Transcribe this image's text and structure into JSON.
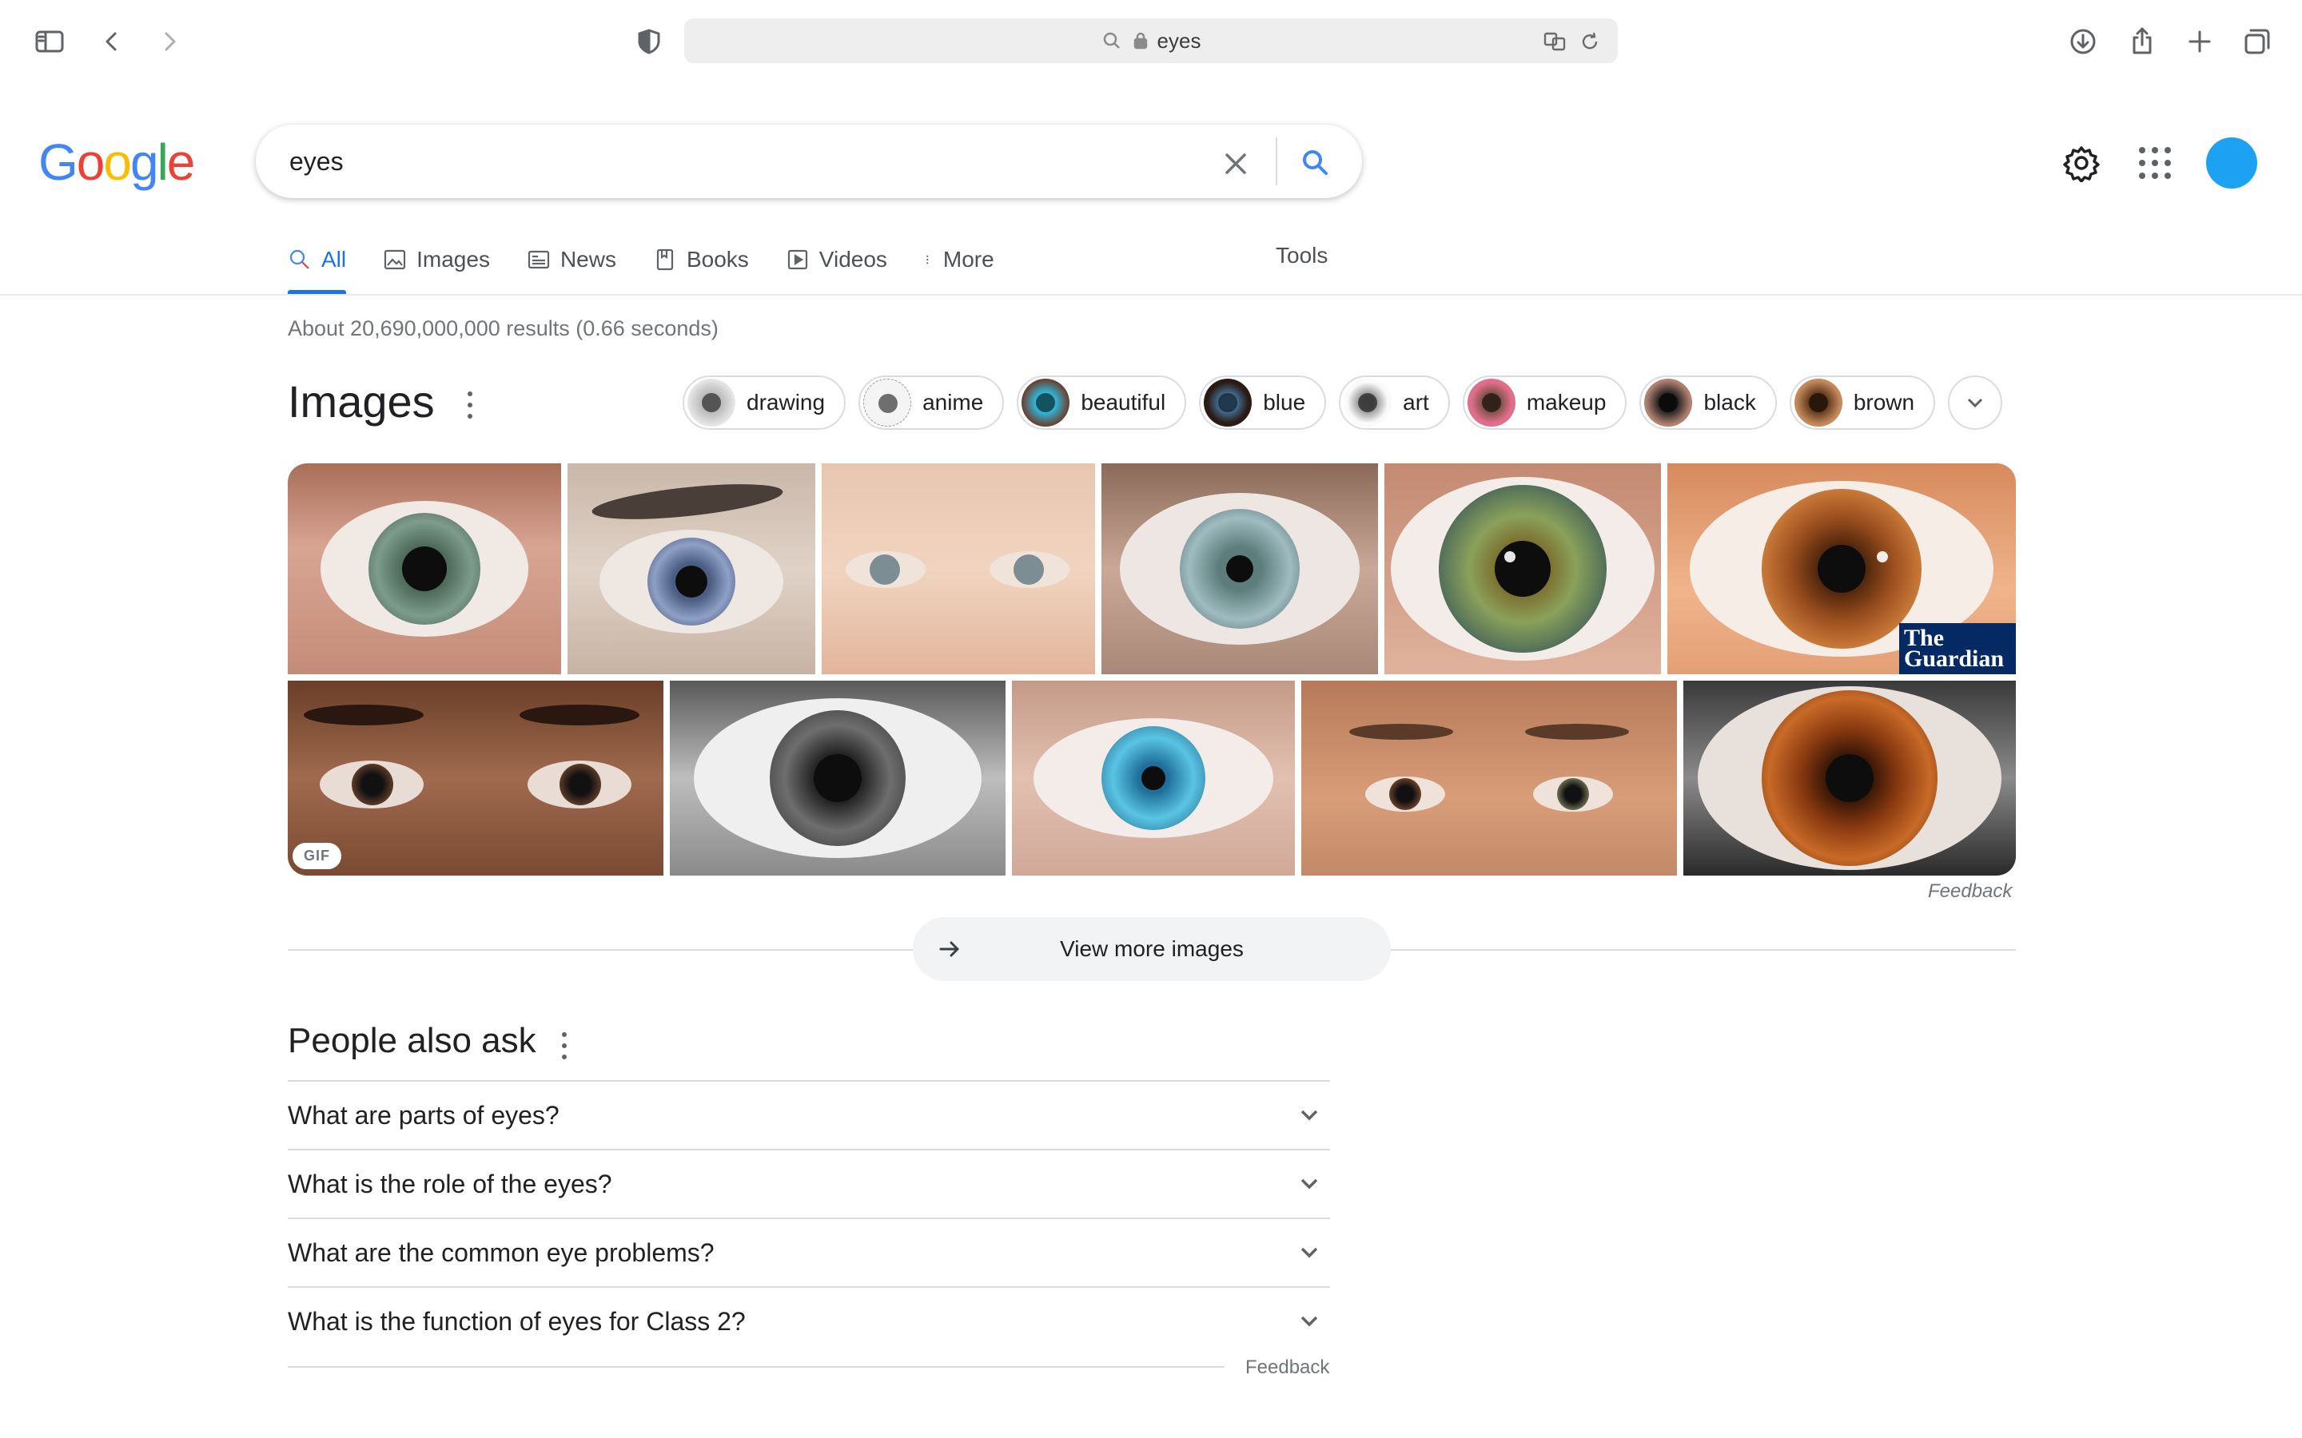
{
  "browser": {
    "address_text": "eyes",
    "icons": [
      "sidebar-icon",
      "back-icon",
      "forward-icon",
      "shield-icon",
      "search-icon",
      "lock-icon",
      "translate-icon",
      "reload-icon",
      "download-icon",
      "share-icon",
      "new-tab-icon",
      "tabs-overview-icon"
    ]
  },
  "google": {
    "logo_letters": [
      "G",
      "o",
      "o",
      "g",
      "l",
      "e"
    ],
    "query": "eyes",
    "avatar_color": "#1da1f2",
    "accent": "#1a73e8"
  },
  "tabs": [
    {
      "label": "All",
      "icon": "search-icon",
      "active": true
    },
    {
      "label": "Images",
      "icon": "image-icon"
    },
    {
      "label": "News",
      "icon": "news-icon"
    },
    {
      "label": "Books",
      "icon": "book-icon"
    },
    {
      "label": "Videos",
      "icon": "video-icon"
    },
    {
      "label": "More",
      "icon": "more-vert-icon"
    }
  ],
  "tools_label": "Tools",
  "result_stats": "About 20,690,000,000 results (0.66 seconds)",
  "images_section": {
    "title": "Images",
    "chips": [
      "drawing",
      "anime",
      "beautiful",
      "blue",
      "art",
      "makeup",
      "black",
      "brown"
    ],
    "gif_badge": "GIF",
    "guardian_logo": "The Guardian",
    "feedback": "Feedback",
    "view_more": "View more images"
  },
  "people_also_ask": {
    "title": "People also ask",
    "questions": [
      "What are parts of eyes?",
      "What is the role of the eyes?",
      "What are the common eye problems?",
      "What is the function of eyes for Class 2?"
    ],
    "feedback": "Feedback"
  }
}
